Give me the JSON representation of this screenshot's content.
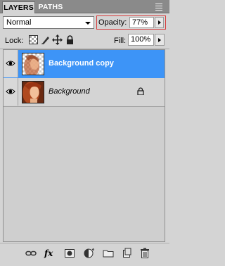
{
  "tabs": [
    {
      "label": "LAYERS",
      "active": true
    },
    {
      "label": "PATHS",
      "active": false
    }
  ],
  "blend_mode": {
    "value": "Normal"
  },
  "opacity": {
    "label": "Opacity:",
    "value": "77%"
  },
  "lock": {
    "label": "Lock:",
    "icons": [
      "lock-transparent-pixels-icon",
      "lock-image-pixels-icon",
      "lock-position-icon",
      "lock-all-icon"
    ]
  },
  "fill": {
    "label": "Fill:",
    "value": "100%"
  },
  "layers": [
    {
      "name": "Background copy",
      "selected": true,
      "visible": true,
      "locked": false
    },
    {
      "name": "Background",
      "selected": false,
      "visible": true,
      "locked": true
    }
  ],
  "bottom_bar": {
    "fx_label": "fx"
  },
  "colors": {
    "selection": "#3d94f7",
    "panel": "#d4d4d4",
    "highlight_box": "#d63a3a",
    "tabbar": "#8a8a8a"
  }
}
